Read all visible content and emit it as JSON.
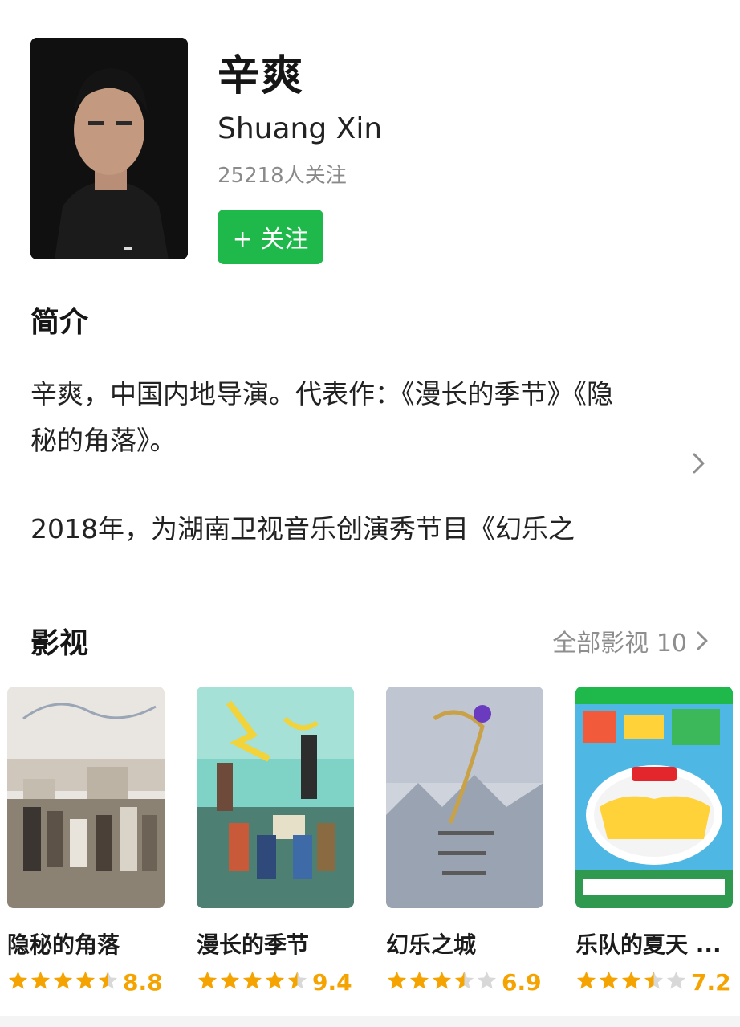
{
  "person": {
    "name": "辛爽",
    "english_name": "Shuang Xin",
    "followers": "25218人关注",
    "follow_label": "+ 关注"
  },
  "intro": {
    "title": "简介",
    "p1": "辛爽，中国内地导演。代表作：《漫长的季节》《隐秘的角落》。",
    "p2": "2018年，为湖南卫视音乐创演秀节目《幻乐之"
  },
  "works": {
    "title": "影视",
    "see_all": "全部影视 10",
    "items": [
      {
        "title": "隐秘的角落",
        "rating": "8.8",
        "stars": 4.5
      },
      {
        "title": "漫长的季节",
        "rating": "9.4",
        "stars": 4.5
      },
      {
        "title": "幻乐之城",
        "rating": "6.9",
        "stars": 3.5
      },
      {
        "title": "乐队的夏天 ...",
        "rating": "7.2",
        "stars": 3.5
      }
    ]
  },
  "colors": {
    "accent_green": "#1fb84b",
    "star": "#f5a300",
    "star_empty": "#d8d8d8"
  }
}
